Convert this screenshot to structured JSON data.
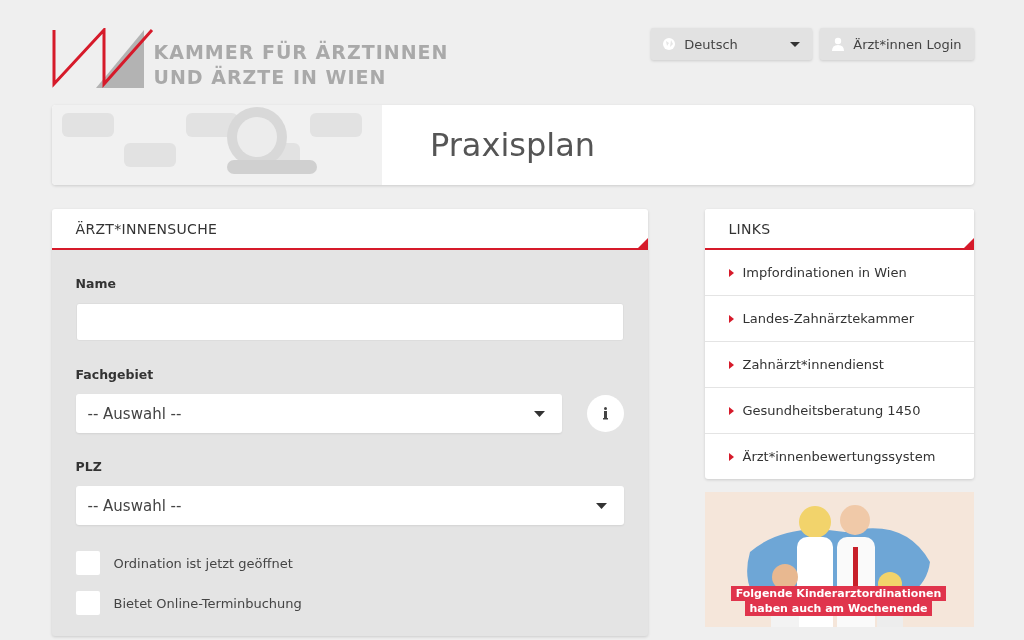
{
  "header": {
    "logo_lines": [
      "KAMMER FÜR ÄRZTINNEN",
      "UND ÄRZTE IN WIEN"
    ],
    "language": "Deutsch",
    "login": "Ärzt*innen Login"
  },
  "banner": {
    "title": "Praxisplan"
  },
  "search": {
    "title": "ÄRZT*INNENSUCHE",
    "fields": [
      {
        "kind": "text",
        "label": "Name"
      },
      {
        "kind": "select",
        "label": "Fachgebiet",
        "value": "-- Auswahl --",
        "info": true
      },
      {
        "kind": "select",
        "label": "PLZ",
        "value": "-- Auswahl --",
        "info": false
      }
    ],
    "checkboxes": [
      {
        "label": "Ordination ist jetzt geöffnet",
        "checked": false
      },
      {
        "label": "Bietet Online-Terminbuchung",
        "checked": false
      }
    ]
  },
  "links": {
    "title": "LINKS",
    "items": [
      "Impfordinationen in Wien",
      "Landes-Zahnärztekammer",
      "Zahnärzt*innendienst",
      "Gesundheitsberatung 1450",
      "Ärzt*innenbewertungssystem"
    ]
  },
  "promo": {
    "kind": "picture",
    "caption_lines": [
      "Folgende Kinderarztordinationen",
      "haben auch am Wochenende"
    ]
  }
}
